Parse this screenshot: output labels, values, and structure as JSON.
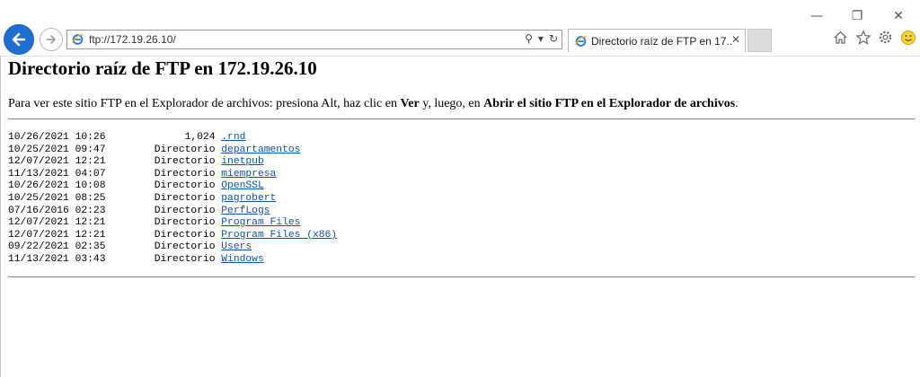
{
  "colors": {
    "link": "#0b53a6",
    "back_button": "#1f6fd1",
    "rule": "#808080"
  },
  "window_controls": {
    "minimize": "—",
    "restore": "❐",
    "close": "✕"
  },
  "address_bar": {
    "url": "ftp://172.19.26.10/",
    "search_icon": "⚲",
    "dropdown_icon": "▾",
    "refresh_icon": "↻"
  },
  "tab": {
    "title": "Directorio raíz de FTP en 17...",
    "close_label": "✕"
  },
  "toolbar_icons": [
    "home-icon",
    "favorites-star-icon",
    "settings-gear-icon",
    "smiley-feedback-icon"
  ],
  "page": {
    "heading": "Directorio raíz de FTP en 172.19.26.10",
    "instructions": {
      "part1": "Para ver este sitio FTP en el Explorador de archivos: presiona Alt, haz clic en ",
      "bold1": "Ver",
      "part2": " y, luego, en ",
      "bold2": "Abrir el sitio FTP en el Explorador de archivos",
      "part3": "."
    },
    "entries": [
      {
        "date": "10/26/2021",
        "time": "10:26",
        "size": "1,024",
        "name": ".rnd"
      },
      {
        "date": "10/25/2021",
        "time": "09:47",
        "size": "Directorio",
        "name": "departamentos"
      },
      {
        "date": "12/07/2021",
        "time": "12:21",
        "size": "Directorio",
        "name": "inetpub"
      },
      {
        "date": "11/13/2021",
        "time": "04:07",
        "size": "Directorio",
        "name": "miempresa"
      },
      {
        "date": "10/26/2021",
        "time": "10:08",
        "size": "Directorio",
        "name": "OpenSSL"
      },
      {
        "date": "10/25/2021",
        "time": "08:25",
        "size": "Directorio",
        "name": "pagrobert"
      },
      {
        "date": "07/16/2016",
        "time": "02:23",
        "size": "Directorio",
        "name": "PerfLogs"
      },
      {
        "date": "12/07/2021",
        "time": "12:21",
        "size": "Directorio",
        "name": "Program Files"
      },
      {
        "date": "12/07/2021",
        "time": "12:21",
        "size": "Directorio",
        "name": "Program Files (x86)"
      },
      {
        "date": "09/22/2021",
        "time": "02:35",
        "size": "Directorio",
        "name": "Users"
      },
      {
        "date": "11/13/2021",
        "time": "03:43",
        "size": "Directorio",
        "name": "Windows"
      }
    ]
  }
}
